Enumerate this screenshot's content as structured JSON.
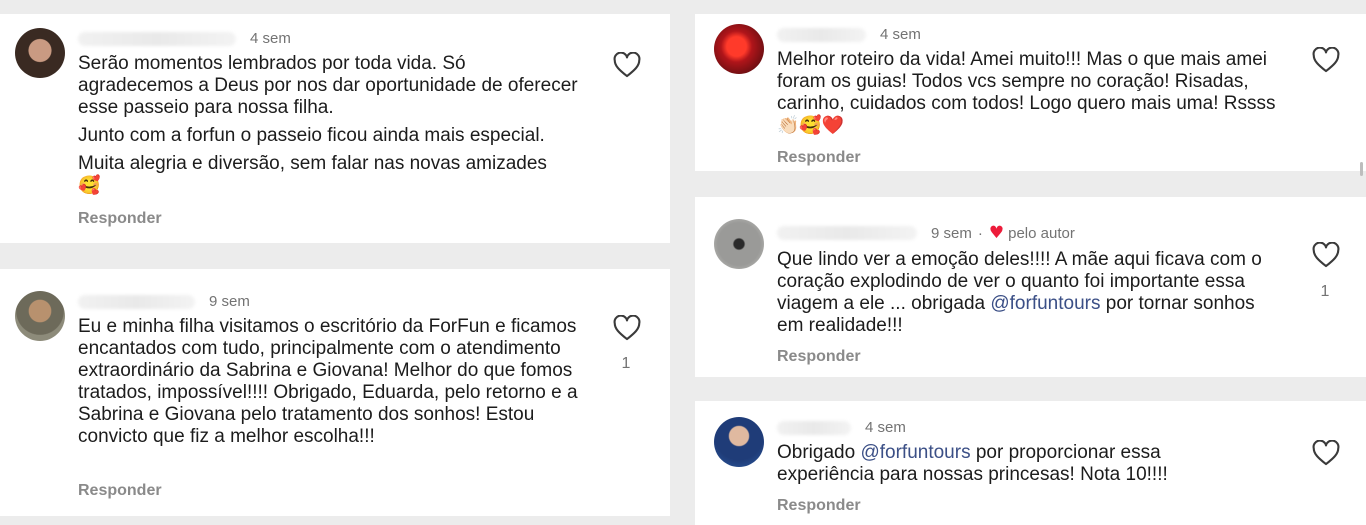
{
  "comments": [
    {
      "time": "4 sem",
      "paragraphs": [
        "Serão momentos lembrados por toda vida. Só agradecemos a Deus por nos dar oportunidade de oferecer esse passeio para nossa filha.",
        "Junto com a forfun o passeio ficou ainda mais especial.",
        "Muita alegria e diversão, sem falar nas novas amizades"
      ],
      "emoji": "🥰",
      "reply_label": "Responder"
    },
    {
      "time": "9 sem",
      "text": "Eu e minha filha visitamos o escritório da ForFun e ficamos encantados com tudo, principalmente com o atendimento extraordinário da Sabrina e Giovana! Melhor do que fomos tratados, impossível!!!! Obrigado, Eduarda, pelo retorno e a Sabrina e Giovana pelo tratamento dos sonhos! Estou convicto que fiz a melhor escolha!!!",
      "likes": "1",
      "reply_label": "Responder"
    },
    {
      "time": "4 sem",
      "text": "Melhor roteiro da vida! Amei muito!!! Mas o que mais amei foram os guias! Todos vcs sempre no coração! Risadas, carinho, cuidados com todos! Logo quero mais uma! Rssss",
      "emoji": "👏🏻🥰❤️",
      "reply_label": "Responder"
    },
    {
      "time": "9 sem",
      "author_like": "pelo autor",
      "text_before": "Que lindo ver a emoção deles!!!! A mãe aqui ficava com o coração explodindo de ver o quanto foi importante essa viagem a ele ... obrigada",
      "mention": "@forfuntours",
      "text_after": " por tornar sonhos em realidade!!!",
      "likes": "1",
      "reply_label": "Responder"
    },
    {
      "time": "4 sem",
      "text_before": "Obrigado ",
      "mention": "@forfuntours",
      "text_after": " por proporcionar essa experiência para nossas princesas! Nota 10!!!!",
      "reply_label": "Responder"
    }
  ],
  "colors": {
    "heart_red": "#ed1c3a",
    "mention": "#3b4f86",
    "background": "#ececec"
  }
}
